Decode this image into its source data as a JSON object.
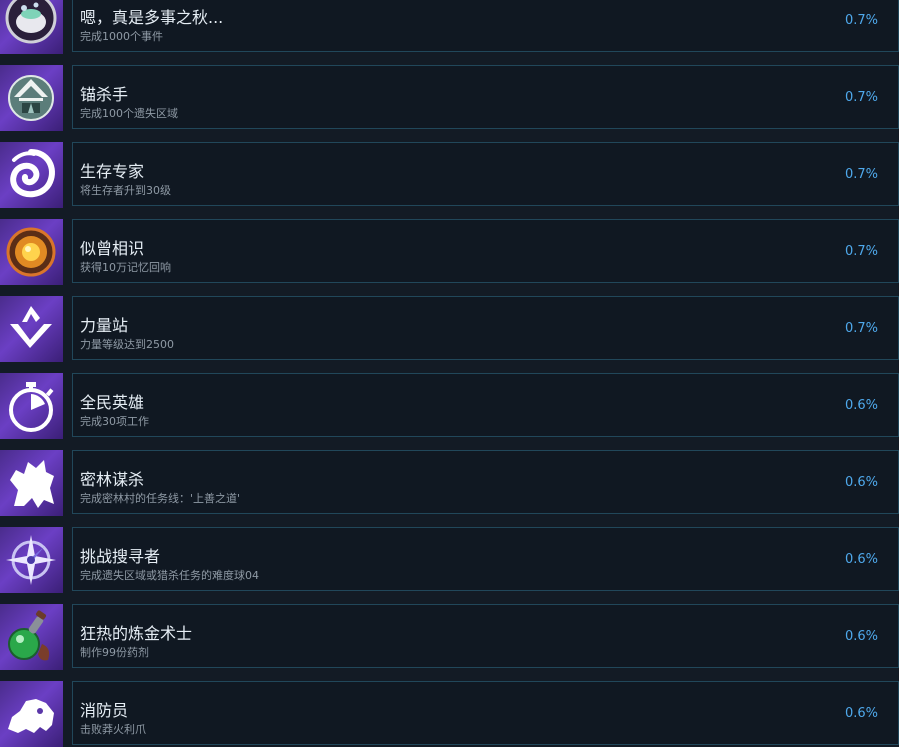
{
  "achievements": [
    {
      "title": "嗯，真是多事之秋...",
      "desc": "完成1000个事件",
      "pct": "0.7%",
      "icon": "cauldron-icon"
    },
    {
      "title": "锚杀手",
      "desc": "完成100个遗失区域",
      "pct": "0.7%",
      "icon": "ruin-gate-icon"
    },
    {
      "title": "生存专家",
      "desc": "将生存者升到30级",
      "pct": "0.7%",
      "icon": "swirl-emblem-icon"
    },
    {
      "title": "似曾相识",
      "desc": "获得10万记忆回响",
      "pct": "0.7%",
      "icon": "glowing-orb-icon"
    },
    {
      "title": "力量站",
      "desc": "力量等级达到2500",
      "pct": "0.7%",
      "icon": "power-chevron-icon"
    },
    {
      "title": "全民英雄",
      "desc": "完成30项工作",
      "pct": "0.6%",
      "icon": "stopwatch-icon"
    },
    {
      "title": "密林谋杀",
      "desc": "完成密林村的任务线：'上善之道'",
      "pct": "0.6%",
      "icon": "beast-silhouette-icon"
    },
    {
      "title": "挑战搜寻者",
      "desc": "完成遗失区域或猎杀任务的难度球04",
      "pct": "0.6%",
      "icon": "compass-star-icon"
    },
    {
      "title": "狂热的炼金术士",
      "desc": "制作99份药剂",
      "pct": "0.6%",
      "icon": "potion-flask-icon"
    },
    {
      "title": "消防员",
      "desc": "击败莽火利爪",
      "pct": "0.6%",
      "icon": "creature-silhouette-icon"
    }
  ]
}
